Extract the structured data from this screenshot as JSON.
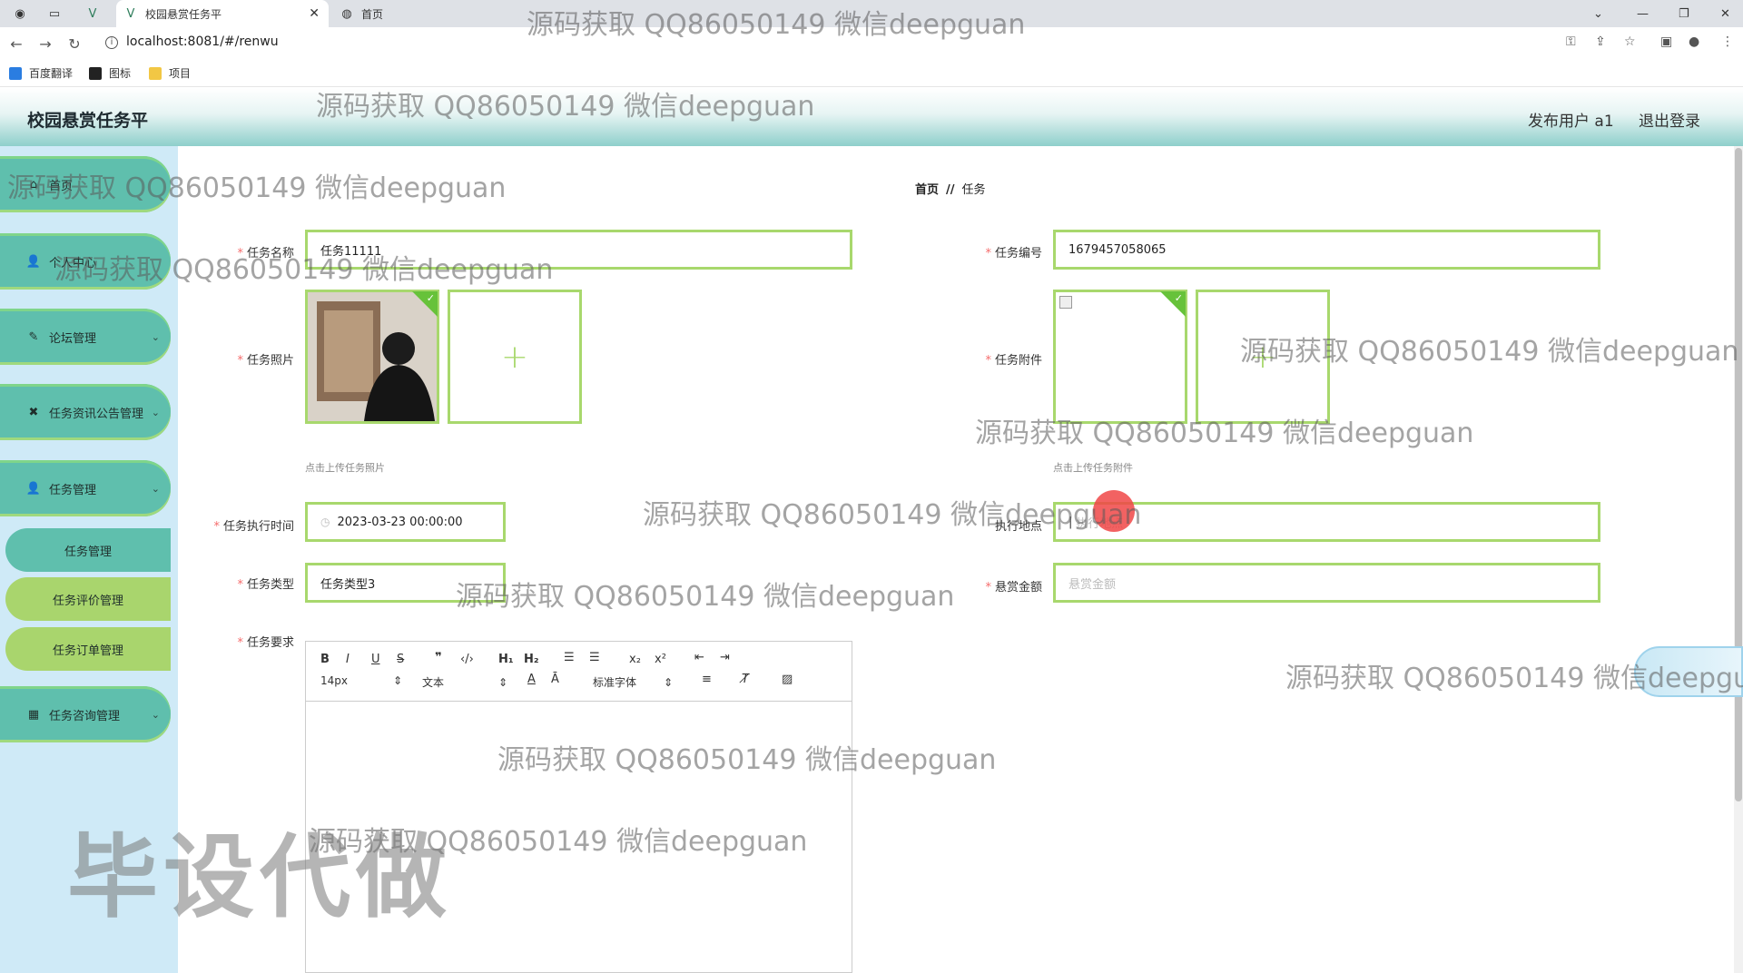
{
  "browser": {
    "tabs": [
      {
        "label": "校园悬赏任务平",
        "active": true
      },
      {
        "label": "首页",
        "active": false
      }
    ],
    "url": "localhost:8081/#/renwu",
    "bookmarks": [
      "百度翻译",
      "图标",
      "项目"
    ]
  },
  "header": {
    "title": "校园悬赏任务平",
    "user": "发布用户 a1",
    "logout": "退出登录"
  },
  "sidebar": {
    "items": [
      {
        "label": "首页",
        "icon": "home-icon"
      },
      {
        "label": "个人中心",
        "icon": "user-icon"
      },
      {
        "label": "论坛管理",
        "icon": "forum-icon"
      },
      {
        "label": "任务资讯公告管理",
        "icon": "news-icon"
      },
      {
        "label": "任务管理",
        "icon": "user-icon"
      },
      {
        "label": "任务咨询管理",
        "icon": "grid-icon"
      }
    ],
    "sub_items": [
      {
        "label": "任务管理",
        "active": true
      },
      {
        "label": "任务评价管理",
        "active": false
      },
      {
        "label": "任务订单管理",
        "active": false
      }
    ]
  },
  "breadcrumb": {
    "home": "首页",
    "separator": "//",
    "current": "任务"
  },
  "form": {
    "task_name": {
      "label": "任务名称",
      "value": "任务11111"
    },
    "task_no": {
      "label": "任务编号",
      "value": "1679457058065"
    },
    "task_photo": {
      "label": "任务照片",
      "hint": "点击上传任务照片"
    },
    "task_attachment": {
      "label": "任务附件",
      "hint": "点击上传任务附件"
    },
    "exec_time": {
      "label": "任务执行时间",
      "value": "2023-03-23 00:00:00"
    },
    "exec_place": {
      "label": "执行地点",
      "placeholder": "执行地点"
    },
    "task_type": {
      "label": "任务类型",
      "value": "任务类型3"
    },
    "reward": {
      "label": "悬赏金额",
      "placeholder": "悬赏金额"
    },
    "requirement": {
      "label": "任务要求"
    }
  },
  "editor_toolbar": {
    "font_size": "14px",
    "block": "文本",
    "font": "标准字体"
  },
  "watermarks": {
    "text": "源码获取 QQ86050149 微信deepguan",
    "big": "毕设代做"
  },
  "colors": {
    "accent_green": "#a8d86d",
    "sidebar_teal": "#5fbfad",
    "required": "#f56c6c"
  }
}
